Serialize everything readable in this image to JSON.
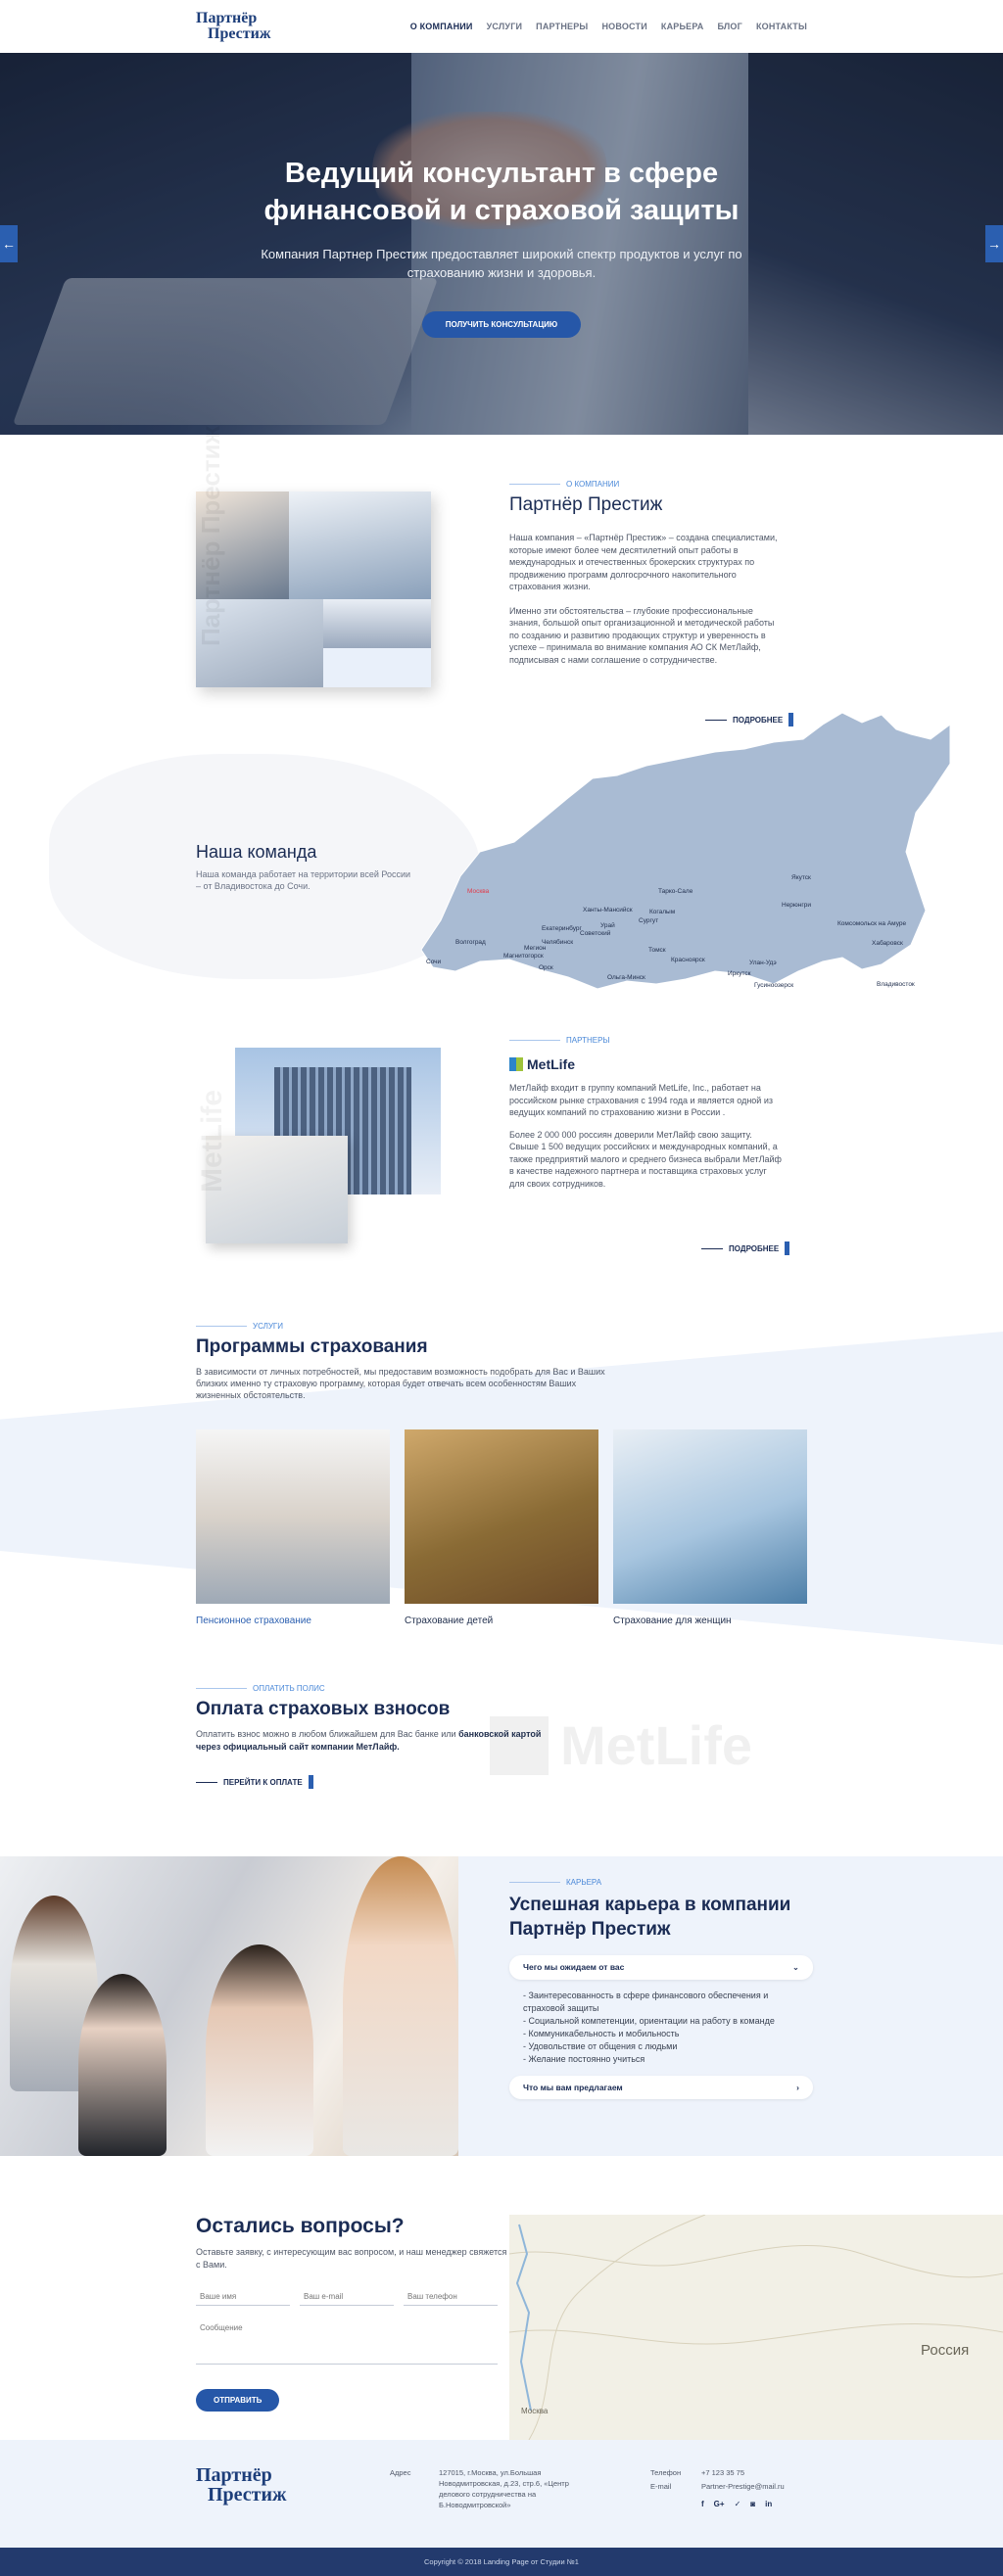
{
  "header": {
    "logo_line1": "Партнёр",
    "logo_line2": "Престиж",
    "nav": [
      "О КОМПАНИИ",
      "УСЛУГИ",
      "ПАРТНЕРЫ",
      "НОВОСТИ",
      "КАРЬЕРА",
      "БЛОГ",
      "КОНТАКТЫ"
    ]
  },
  "hero": {
    "title": "Ведущий консультант в сфере финансовой и страховой защиты",
    "subtitle": "Компания Партнер Престиж предоставляет широкий спектр продуктов и услуг по страхованию жизни и здоровья.",
    "button": "ПОЛУЧИТЬ КОНСУЛЬТАЦИЮ",
    "arrow_left": "←",
    "arrow_right": "→"
  },
  "about": {
    "label": "О КОМПАНИИ",
    "title": "Партнёр Престиж",
    "vertical": "Партнёр Престиж",
    "p1": "Наша компания – «Партнёр Престиж» – создана специалистами, которые имеют более чем десятилетний опыт работы в международных и отечественных брокерских структурах по продвижению программ долгосрочного накопительного страхования жизни.",
    "p2": "Именно эти обстоятельства – глубокие профессиональные знания, большой опыт организационной и методической работы по созданию и развитию продающих структур и уверенность в успехе – принимала во внимание компания АО СК МетЛайф, подписывая с нами соглашение о сотрудничестве.",
    "more": "ПОДРОБНЕЕ"
  },
  "team": {
    "title": "Наша команда",
    "text": "Наша команда работает на территории всей России – от Владивостока до Сочи.",
    "cities": [
      "Москва",
      "Таркo-Сале",
      "Якутск",
      "Нерюнгри",
      "Ханты-Мансийск",
      "Когалым",
      "Сургут",
      "Екатеринбург",
      "Урай",
      "Советский",
      "Волгоград",
      "Челябинск",
      "Мегион",
      "Магнитогорск",
      "Томск",
      "Комсомольск на Амуре",
      "Хабаровск",
      "Сочи",
      "Орск",
      "Красноярск",
      "Улан-Удэ",
      "Иркутск",
      "Гусиноозерск",
      "Владивосток",
      "Ольга-Минск"
    ]
  },
  "partners": {
    "label": "ПАРТНЕРЫ",
    "brand": "MetLife",
    "vertical": "MetLife",
    "p1": "МетЛайф входит в группу компаний MetLife, Inc., работает на российском рынке страхования с 1994 года и является одной из ведущих компаний по страхованию жизни в России .",
    "p2": "Более 2 000 000 россиян доверили МетЛайф свою защиту. Свыше 1 500 ведущих российских и международных компаний, а также предприятий малого и среднего бизнеса выбрали МетЛайф в качестве надежного партнера и поставщика страховых услуг для своих сотрудников.",
    "more": "ПОДРОБНЕЕ"
  },
  "programs": {
    "label": "УСЛУГИ",
    "title": "Программы страхования",
    "text": "В зависимости от личных потребностей, мы предоставим возможность подобрать для Вас и Ваших близких именно ту страховую программу, которая будет отвечать всем особенностям Ваших жизненных обстоятельств.",
    "cards": [
      {
        "caption": "Пенсионное страхование"
      },
      {
        "caption": "Страхование детей"
      },
      {
        "caption": "Страхование для женщин"
      }
    ]
  },
  "payment": {
    "label": "ОПЛАТИТЬ ПОЛИС",
    "title": "Оплата страховых взносов",
    "text_start": "Оплатить взнос можно в любом ближайшем для Вас банке или ",
    "text_bold": "банковской картой через официальный сайт компании МетЛайф.",
    "link": "ПЕРЕЙТИ К ОПЛАТЕ",
    "ghost_brand": "MetLife"
  },
  "career": {
    "label": "КАРЬЕРА",
    "title": "Успешная карьера в компании Партнёр Престиж",
    "acc1": "Чего мы ожидаем от вас",
    "acc1_icon": "⌄",
    "items": [
      "- Заинтересованность в сфере финансового обеспечения и страховой защиты",
      "- Социальной компетенции, ориентации на работу в команде",
      "- Коммуникабельность и мобильность",
      "- Удовольствие от общения с людьми",
      "- Желание постоянно учиться"
    ],
    "acc2": "Что мы вам предлагаем",
    "acc2_icon": "›"
  },
  "contact": {
    "title": "Остались вопросы?",
    "text": "Оставьте заявку, с интересующим вас вопросом, и наш менеджер свяжется с Вами.",
    "name_ph": "Ваше имя",
    "email_ph": "Ваш e-mail",
    "phone_ph": "Ваш телефон",
    "message_ph": "Сообщение",
    "button": "ОТПРАВИТЬ",
    "map_labels": [
      "Россия",
      "Москва"
    ]
  },
  "footer": {
    "address_label": "Адрес",
    "address": "127015, г.Москва, ул.Большая Новодмитровская, д.23, стр.6, «Центр делового сотрудничества на Б.Новодмитровской»",
    "phone_label": "Телефон",
    "phone": "+7 123 35 75",
    "email_label": "E-mail",
    "email": "Partner-Prestige@mail.ru",
    "socials": [
      "f",
      "G+",
      "✓",
      "◙",
      "in"
    ],
    "copyright": "Copyright © 2018 Landing Page от Студии №1"
  }
}
